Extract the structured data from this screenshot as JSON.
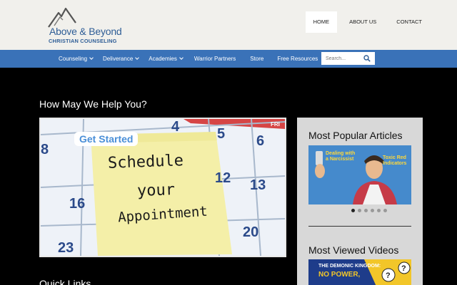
{
  "brand": {
    "name_line1": "Above & Beyond",
    "name_line2": "CHRISTIAN COUNSELING",
    "colors": {
      "primary": "#3a72b8",
      "logo_blue": "#2e5d96",
      "header_bg": "#f1f0ec"
    }
  },
  "top_nav": [
    {
      "label": "HOME",
      "active": true
    },
    {
      "label": "ABOUT US",
      "active": false
    },
    {
      "label": "CONTACT",
      "active": false
    }
  ],
  "main_nav": [
    {
      "label": "Counseling",
      "dropdown": true
    },
    {
      "label": "Deliverance",
      "dropdown": true
    },
    {
      "label": "Academies",
      "dropdown": true
    },
    {
      "label": "Warrior Partners",
      "dropdown": false
    },
    {
      "label": "Store",
      "dropdown": false
    },
    {
      "label": "Free Resources",
      "dropdown": false
    }
  ],
  "search": {
    "placeholder": "Search...",
    "icon": "search-icon"
  },
  "main": {
    "heading": "How May We Help You?",
    "hero": {
      "tag": "Get Started",
      "note_lines": [
        "Schedule",
        "your",
        "Appointment"
      ],
      "calendar_numbers": [
        "4",
        "5",
        "6",
        "8",
        "12",
        "13",
        "16",
        "20",
        "23"
      ],
      "calendar_day": "FRI"
    },
    "quick_links_heading": "Quick Links"
  },
  "sidebar": {
    "popular_title": "Most Popular Articles",
    "article_texts": [
      "Dealing with a Narcissist",
      "Toxic Red Indicators"
    ],
    "carousel": {
      "count": 6,
      "active_index": 0
    },
    "videos_title": "Most Viewed Videos",
    "video_texts": [
      "THE DEMONIC KINGDOM:",
      "NO POWER,"
    ]
  }
}
